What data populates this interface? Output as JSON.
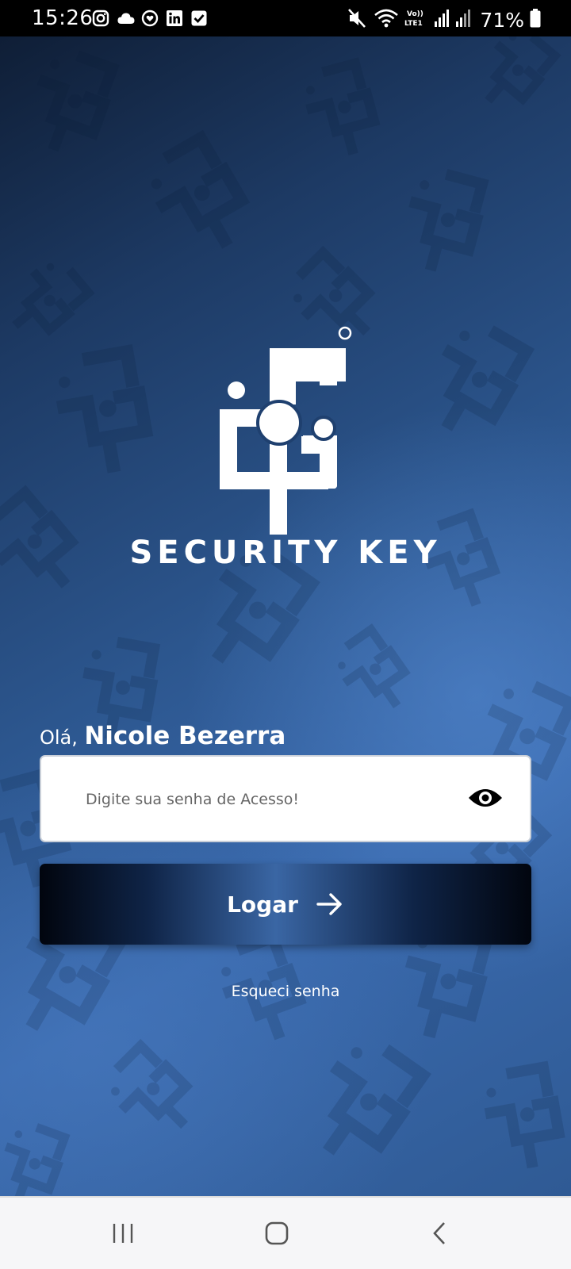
{
  "status_bar": {
    "time": "15:26",
    "battery": "71%",
    "left_icons": [
      "instagram-icon",
      "cloud-icon",
      "heart-app-icon",
      "linkedin-icon",
      "checkbox-icon"
    ],
    "right_icons": [
      "mute-icon",
      "wifi-icon",
      "volte-icon",
      "signal-icon",
      "signal-icon",
      "battery-icon"
    ],
    "volte_text": "Vo)) LTE1"
  },
  "brand": {
    "name": "SECURITY KEY",
    "logo_icon": "security-key-logo"
  },
  "login": {
    "greeting_prefix": "Olá,",
    "user_name": "Nicole Bezerra",
    "password_placeholder": "Digite sua senha de Acesso!",
    "password_value": "",
    "show_password_icon": "eye-icon",
    "login_button_label": "Logar",
    "login_button_icon": "arrow-right-icon",
    "forgot_password_label": "Esqueci senha"
  },
  "nav_bar": {
    "buttons": [
      "recent-apps-icon",
      "home-icon",
      "back-icon"
    ]
  },
  "colors": {
    "background_dark": "#0f1e36",
    "background_mid": "#2c568e",
    "background_light": "#3a6aae",
    "button_center": "#3a66a4",
    "button_edge": "#01050e",
    "text": "#ffffff"
  }
}
